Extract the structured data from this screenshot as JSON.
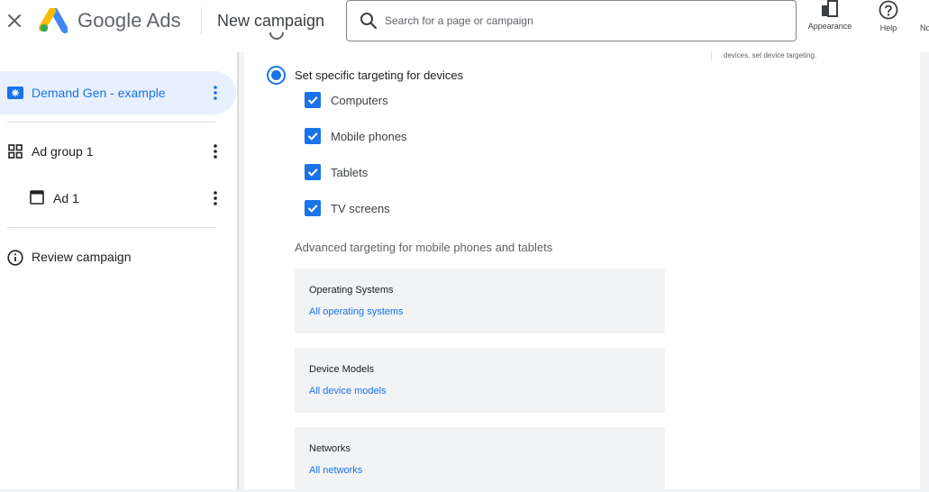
{
  "header": {
    "brand": "Google Ads",
    "page_title": "New campaign",
    "search_placeholder": "Search for a page or campaign",
    "tools": [
      {
        "label": "Appearance",
        "icon": "appearance-icon"
      },
      {
        "label": "Help",
        "icon": "help-icon"
      },
      {
        "label": "No",
        "icon": "notifications-icon"
      }
    ]
  },
  "sidebar": {
    "campaign": {
      "label": "Demand Gen - example",
      "icon": "campaign-icon"
    },
    "ad_group": {
      "label": "Ad group 1",
      "icon": "ad-group-icon"
    },
    "ad": {
      "label": "Ad 1",
      "icon": "ad-icon"
    },
    "review": {
      "label": "Review campaign",
      "icon": "info-icon"
    }
  },
  "main": {
    "side_note": "devices, set device targeting.",
    "device_radio": {
      "label": "Set specific targeting for devices",
      "selected": true
    },
    "devices": [
      {
        "label": "Computers",
        "checked": true
      },
      {
        "label": "Mobile phones",
        "checked": true
      },
      {
        "label": "Tablets",
        "checked": true
      },
      {
        "label": "TV screens",
        "checked": true
      }
    ],
    "advanced_title": "Advanced targeting for mobile phones and tablets",
    "advanced": [
      {
        "title": "Operating Systems",
        "value": "All operating systems"
      },
      {
        "title": "Device Models",
        "value": "All device models"
      },
      {
        "title": "Networks",
        "value": "All networks"
      }
    ]
  },
  "colors": {
    "accent": "#1a73e8",
    "active_bg": "#e8f0fe",
    "card_bg": "#f1f3f4"
  }
}
